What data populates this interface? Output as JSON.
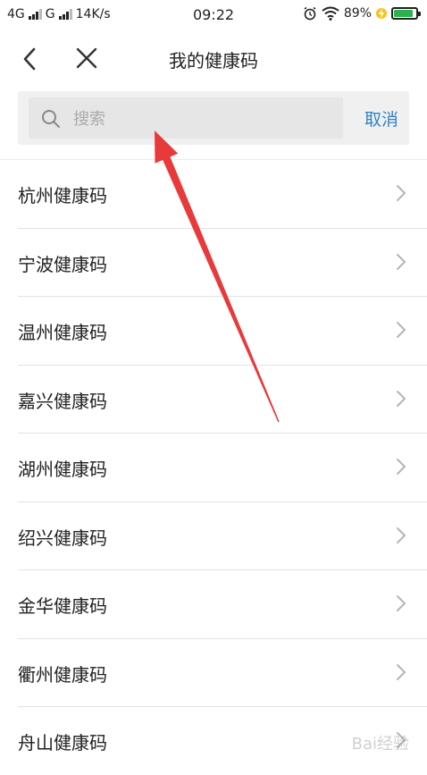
{
  "status_bar": {
    "network_1": "4G",
    "network_2": "G",
    "speed": "14K/s",
    "time": "09:22",
    "battery": "89%",
    "battery_level": 0.89
  },
  "nav": {
    "title": "我的健康码"
  },
  "search": {
    "placeholder": "搜索",
    "value": "",
    "cancel_label": "取消"
  },
  "list": {
    "items": [
      {
        "label": "杭州健康码"
      },
      {
        "label": "宁波健康码"
      },
      {
        "label": "温州健康码"
      },
      {
        "label": "嘉兴健康码"
      },
      {
        "label": "湖州健康码"
      },
      {
        "label": "绍兴健康码"
      },
      {
        "label": "金华健康码"
      },
      {
        "label": "衢州健康码"
      },
      {
        "label": "舟山健康码"
      }
    ]
  },
  "colors": {
    "accent": "#2f84c5",
    "annotation_arrow": "#e83a3a",
    "battery": "#2bb24c"
  },
  "watermark": "Bai经验"
}
